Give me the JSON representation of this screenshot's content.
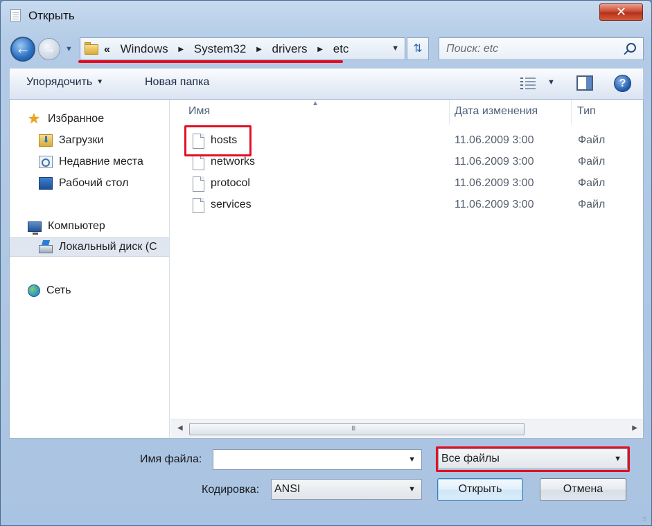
{
  "window": {
    "title": "Открыть",
    "close_label": "✕"
  },
  "nav": {
    "back_label": "←",
    "forward_label": "→",
    "dropdown_label": "▼"
  },
  "address": {
    "lead": "«",
    "segments": [
      "Windows",
      "System32",
      "drivers",
      "etc"
    ],
    "separator": "▶",
    "dropdown_label": "▼",
    "refresh_label": "⇅"
  },
  "search": {
    "placeholder": "Поиск: etc"
  },
  "toolbar": {
    "organize_label": "Упорядочить",
    "organize_caret": "▼",
    "new_folder_label": "Новая папка",
    "views_dd_label": "▼",
    "help_label": "?"
  },
  "navpane": {
    "favorites_label": "Избранное",
    "favorites_icon": "★",
    "downloads_label": "Загрузки",
    "recent_label": "Недавние места",
    "desktop_label": "Рабочий стол",
    "computer_label": "Компьютер",
    "local_disk_label": "Локальный диск (С",
    "network_label": "Сеть"
  },
  "columns": {
    "name": "Имя",
    "date": "Дата изменения",
    "type": "Тип",
    "sort_indicator": "▲"
  },
  "files": [
    {
      "name": "hosts",
      "date": "11.06.2009 3:00",
      "type": "Файл"
    },
    {
      "name": "networks",
      "date": "11.06.2009 3:00",
      "type": "Файл"
    },
    {
      "name": "protocol",
      "date": "11.06.2009 3:00",
      "type": "Файл"
    },
    {
      "name": "services",
      "date": "11.06.2009 3:00",
      "type": "Файл"
    }
  ],
  "scrollbar": {
    "left_label": "◀",
    "right_label": "▶",
    "grip_label": "III"
  },
  "form": {
    "filename_label": "Имя файла:",
    "filename_value": "",
    "filename_caret": "▼",
    "filter_value": "Все файлы",
    "filter_caret": "▼",
    "encoding_label": "Кодировка:",
    "encoding_value": "ANSI",
    "encoding_caret": "▼",
    "open_label": "Открыть",
    "cancel_label": "Отмена"
  },
  "colors": {
    "highlight": "#e01023",
    "selected_nav": "#dfe6ef"
  }
}
